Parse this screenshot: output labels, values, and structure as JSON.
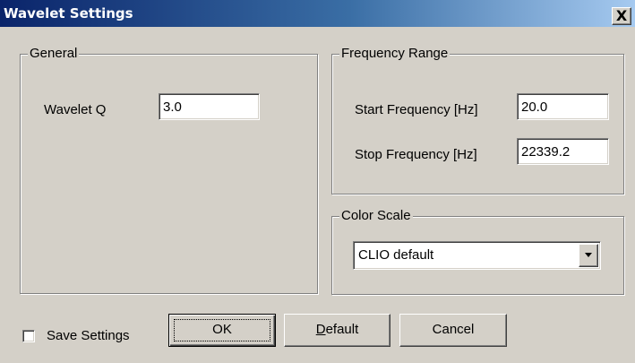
{
  "window": {
    "title": "Wavelet Settings",
    "close_label": "X"
  },
  "general": {
    "legend": "General",
    "wavelet_q_label": "Wavelet Q",
    "wavelet_q_value": "3.0"
  },
  "frequency_range": {
    "legend": "Frequency Range",
    "start_label": "Start Frequency [Hz]",
    "start_value": "20.0",
    "stop_label": "Stop Frequency [Hz]",
    "stop_value": "22339.2"
  },
  "color_scale": {
    "legend": "Color Scale",
    "selected": "CLIO default"
  },
  "footer": {
    "save_settings_label": "Save Settings",
    "save_settings_checked": false,
    "ok_label": "OK",
    "default_label": "Default",
    "cancel_label": "Cancel"
  }
}
